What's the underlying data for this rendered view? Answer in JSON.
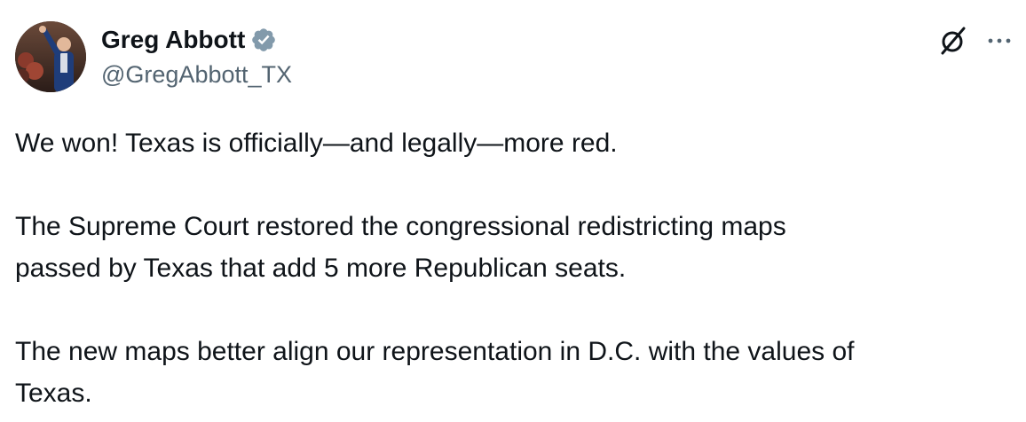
{
  "tweet": {
    "author": {
      "display_name": "Greg Abbott",
      "handle": "@GregAbbott_TX",
      "verified_icon": "verified-badge-icon",
      "verified_color": "#829aab"
    },
    "actions": {
      "grok_icon": "grok-icon",
      "more_icon": "more-options-icon"
    },
    "body": {
      "p1": "We won! Texas is officially—and legally—more red.",
      "p2_line1": "The Supreme Court restored the congressional redistricting maps",
      "p2_line2": "passed by Texas that add 5 more Republican seats.",
      "p3_line1": "The new maps better align our representation in D.C. with the values of",
      "p3_line2": "Texas."
    },
    "colors": {
      "text_primary": "#0f1419",
      "text_secondary": "#536471"
    }
  }
}
